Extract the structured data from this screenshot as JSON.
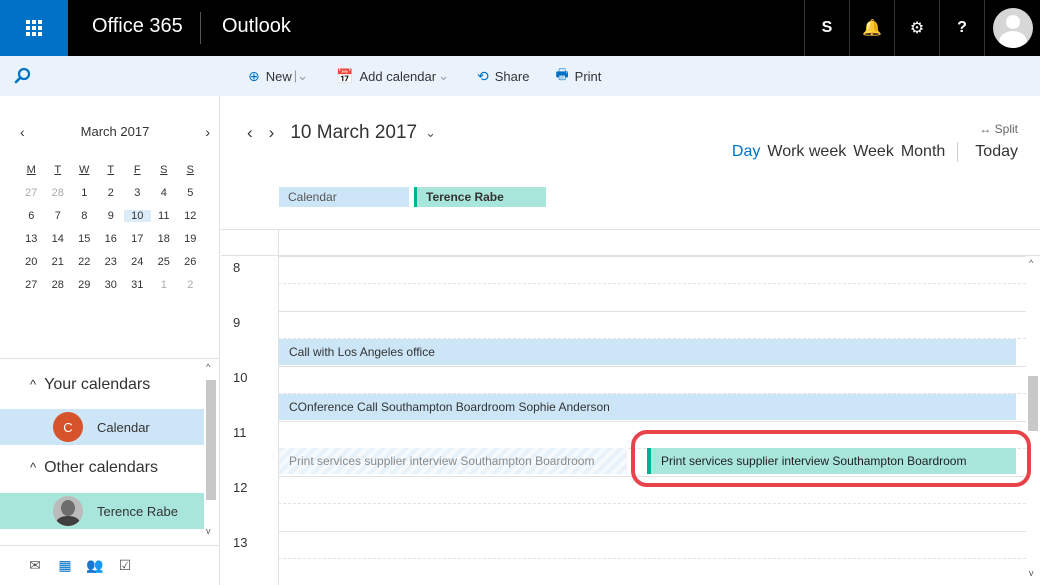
{
  "topbar": {
    "brand": "Office 365",
    "app": "Outlook",
    "icons": [
      "skype-icon",
      "bell-icon",
      "gear-icon",
      "help-icon"
    ],
    "icon_glyphs": [
      "S",
      "🔔",
      "⚙",
      "?"
    ]
  },
  "commands": [
    {
      "name": "new",
      "label": "New",
      "icon": "plus-circle-icon",
      "glyph": "⊕",
      "dropdown": true
    },
    {
      "name": "add-calendar",
      "label": "Add calendar",
      "icon": "calendar-add-icon",
      "glyph": "📅",
      "dropdown": true
    },
    {
      "name": "share",
      "label": "Share",
      "icon": "share-icon",
      "glyph": "⟲",
      "dropdown": false
    },
    {
      "name": "print",
      "label": "Print",
      "icon": "print-icon",
      "glyph": "🖶",
      "dropdown": false
    }
  ],
  "mini_calendar": {
    "month_label": "March 2017",
    "weekdays": [
      "M",
      "T",
      "W",
      "T",
      "F",
      "S",
      "S"
    ],
    "weeks": [
      [
        {
          "d": "27",
          "dim": true
        },
        {
          "d": "28",
          "dim": true
        },
        {
          "d": "1"
        },
        {
          "d": "2"
        },
        {
          "d": "3"
        },
        {
          "d": "4"
        },
        {
          "d": "5"
        }
      ],
      [
        {
          "d": "6"
        },
        {
          "d": "7"
        },
        {
          "d": "8"
        },
        {
          "d": "9"
        },
        {
          "d": "10",
          "sel": true
        },
        {
          "d": "11"
        },
        {
          "d": "12"
        }
      ],
      [
        {
          "d": "13"
        },
        {
          "d": "14"
        },
        {
          "d": "15"
        },
        {
          "d": "16"
        },
        {
          "d": "17"
        },
        {
          "d": "18"
        },
        {
          "d": "19"
        }
      ],
      [
        {
          "d": "20"
        },
        {
          "d": "21"
        },
        {
          "d": "22"
        },
        {
          "d": "23"
        },
        {
          "d": "24"
        },
        {
          "d": "25"
        },
        {
          "d": "26"
        }
      ],
      [
        {
          "d": "27"
        },
        {
          "d": "28"
        },
        {
          "d": "29"
        },
        {
          "d": "30"
        },
        {
          "d": "31"
        },
        {
          "d": "1",
          "dim": true
        },
        {
          "d": "2",
          "dim": true
        }
      ]
    ]
  },
  "sidebar": {
    "your_calendars": "Your calendars",
    "calendar_item": {
      "label": "Calendar",
      "initial": "C"
    },
    "other_calendars": "Other calendars",
    "person_item": {
      "label": "Terence Rabe"
    }
  },
  "bottom_nav": [
    {
      "name": "mail-icon",
      "glyph": "✉",
      "active": false
    },
    {
      "name": "calendar-icon",
      "glyph": "▦",
      "active": true
    },
    {
      "name": "people-icon",
      "glyph": "👥",
      "active": false
    },
    {
      "name": "tasks-icon",
      "glyph": "☑",
      "active": false
    }
  ],
  "main": {
    "date_title": "10 March 2017",
    "split_label": "↔ Split",
    "views": [
      {
        "label": "Day",
        "active": true
      },
      {
        "label": "Work week",
        "active": false
      },
      {
        "label": "Week",
        "active": false
      },
      {
        "label": "Month",
        "active": false
      }
    ],
    "today_label": "Today",
    "tags": {
      "calendar": "Calendar",
      "person": "Terence Rabe"
    },
    "hours": [
      "8",
      "9",
      "10",
      "11",
      "12",
      "13"
    ],
    "events": {
      "la_call": "Call with Los Angeles office",
      "conf_call": "COnference Call Southampton Boardroom Sophie Anderson",
      "ghost": "Print services supplier interview Southampton Boardroom",
      "interview": "Print services supplier interview Southampton Boardroom"
    }
  }
}
